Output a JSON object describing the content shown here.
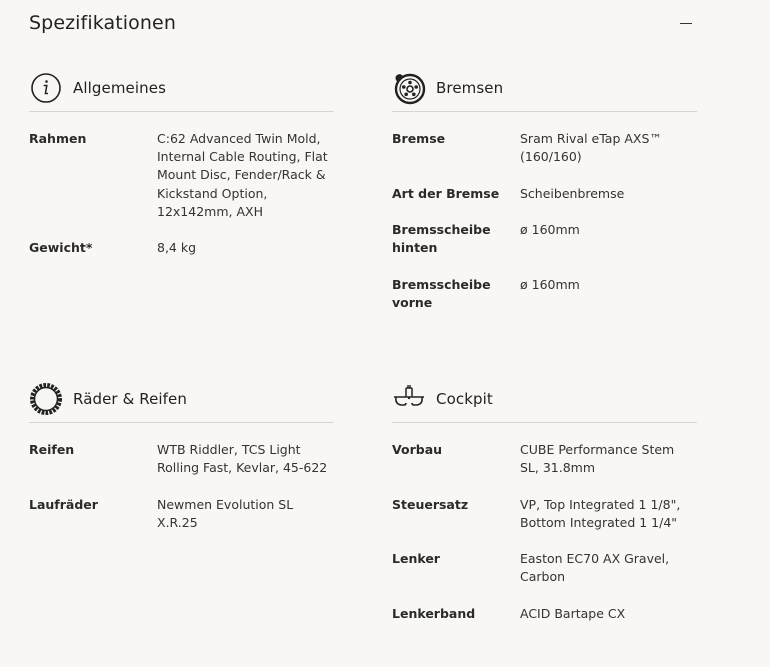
{
  "title": "Spezifikationen",
  "sections": {
    "general": {
      "title": "Allgemeines",
      "rows": [
        {
          "key": "Rahmen",
          "value": "C:62 Advanced Twin Mold, Internal Cable Routing, Flat Mount Disc, Fender/Rack & Kickstand Option, 12x142mm, AXH"
        },
        {
          "key": "Gewicht*",
          "value": "8,4 kg"
        }
      ]
    },
    "brakes": {
      "title": "Bremsen",
      "rows": [
        {
          "key": "Bremse",
          "value": "Sram Rival eTap AXS™ (160/160)"
        },
        {
          "key": "Art der Bremse",
          "value": "Scheibenbremse"
        },
        {
          "key": "Bremsscheibe hinten",
          "value": "ø 160mm"
        },
        {
          "key": "Bremsscheibe vorne",
          "value": "ø 160mm"
        }
      ]
    },
    "wheels": {
      "title": "Räder & Reifen",
      "rows": [
        {
          "key": "Reifen",
          "value": "WTB Riddler, TCS Light Rolling Fast, Kevlar, 45-622"
        },
        {
          "key": "Laufräder",
          "value": "Newmen Evolution SL X.R.25"
        }
      ]
    },
    "cockpit": {
      "title": "Cockpit",
      "rows": [
        {
          "key": "Vorbau",
          "value": "CUBE Performance Stem SL, 31.8mm"
        },
        {
          "key": "Steuersatz",
          "value": "VP, Top Integrated 1 1/8\", Bottom Integrated 1 1/4\""
        },
        {
          "key": "Lenker",
          "value": "Easton EC70 AX Gravel, Carbon"
        },
        {
          "key": "Lenkerband",
          "value": "ACID Bartape CX"
        }
      ]
    }
  },
  "icons": {
    "collapse": "minus-icon",
    "general": "info-icon",
    "brakes": "brake-disc-icon",
    "wheels": "tire-icon",
    "cockpit": "handlebar-icon"
  }
}
